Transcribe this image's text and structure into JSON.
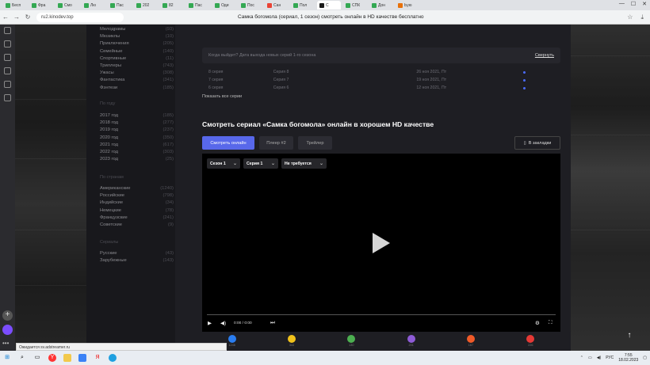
{
  "browser": {
    "tabs": [
      {
        "label": "Бесп",
        "color": "#34a853"
      },
      {
        "label": "Фра",
        "color": "#34a853"
      },
      {
        "label": "Смо",
        "color": "#34a853"
      },
      {
        "label": "Лю",
        "color": "#34a853"
      },
      {
        "label": "Пас",
        "color": "#34a853"
      },
      {
        "label": "202",
        "color": "#34a853"
      },
      {
        "label": "82",
        "color": "#34a853"
      },
      {
        "label": "Пас",
        "color": "#34a853"
      },
      {
        "label": "Оди",
        "color": "#34a853"
      },
      {
        "label": "Пос",
        "color": "#34a853"
      },
      {
        "label": "Сан",
        "color": "#ea4335"
      },
      {
        "label": "Пол",
        "color": "#34a853"
      },
      {
        "label": "С",
        "color": "#1a1a1a",
        "active": true
      },
      {
        "label": "СПК",
        "color": "#34a853"
      },
      {
        "label": "Дон",
        "color": "#34a853"
      },
      {
        "label": "Ьую",
        "color": "#e8710a"
      }
    ],
    "url": "ru2.kinodev.top",
    "page_title": "Самка богомола (сериал, 1 сезон) смотреть онлайн в HD качестве бесплатно",
    "status_text": "Ожидается sv.adstreamer.ru"
  },
  "categories": [
    {
      "label": "Мелодрамы",
      "count": "(93)"
    },
    {
      "label": "Мюзиклы",
      "count": "(10)"
    },
    {
      "label": "Приключения",
      "count": "(205)"
    },
    {
      "label": "Семейные",
      "count": "(140)"
    },
    {
      "label": "Спортивные",
      "count": "(11)"
    },
    {
      "label": "Триллеры",
      "count": "(743)"
    },
    {
      "label": "Ужасы",
      "count": "(308)"
    },
    {
      "label": "Фантастика",
      "count": "(341)"
    },
    {
      "label": "Фэнтези",
      "count": "(185)"
    }
  ],
  "by_year": {
    "title": "По году",
    "items": [
      {
        "label": "2017 год",
        "count": "(185)"
      },
      {
        "label": "2018 год",
        "count": "(277)"
      },
      {
        "label": "2019 год",
        "count": "(237)"
      },
      {
        "label": "2020 год",
        "count": "(350)"
      },
      {
        "label": "2021 год",
        "count": "(617)"
      },
      {
        "label": "2022 год",
        "count": "(303)"
      },
      {
        "label": "2023 год",
        "count": "(25)"
      }
    ]
  },
  "by_country": {
    "title": "По странам",
    "items": [
      {
        "label": "Американские",
        "count": "(1240)"
      },
      {
        "label": "Российские",
        "count": "(798)"
      },
      {
        "label": "Индийские",
        "count": "(34)"
      },
      {
        "label": "Немецкие",
        "count": "(78)"
      },
      {
        "label": "Французские",
        "count": "(241)"
      },
      {
        "label": "Советские",
        "count": "(9)"
      }
    ]
  },
  "series_group": {
    "title": "Сериалы",
    "items": [
      {
        "label": "Русские",
        "count": "(43)"
      },
      {
        "label": "Зарубежные",
        "count": "(143)"
      }
    ]
  },
  "release": {
    "question": "Когда выйдет? Дата выхода новых серий 1-го сезона",
    "collapse": "Свернуть"
  },
  "episodes": [
    {
      "num": "8 серия",
      "name": "Серия 8",
      "date": "26 ноя 2021, Пт"
    },
    {
      "num": "7 серия",
      "name": "Серия 7",
      "date": "19 ноя 2021, Пт"
    },
    {
      "num": "6 серия",
      "name": "Серия 6",
      "date": "12 ноя 2021, Пт"
    }
  ],
  "show_all": "Показать все серии",
  "watch_heading": "Смотреть сериал «Самка богомола» онлайн в хорошем HD качестве",
  "player_tabs": [
    "Смотреть онлайн",
    "Плеер #2",
    "Трейлер"
  ],
  "bookmark_label": "В закладки",
  "player": {
    "season": "Сезон 1",
    "episode": "Серия 1",
    "translation": "Не требуется",
    "time": "0:00 / 0:00"
  },
  "reactions": [
    {
      "name": "like",
      "color": "#2a7df0",
      "count": "1246"
    },
    {
      "name": "laugh",
      "color": "#f1c21b",
      "count": "344"
    },
    {
      "name": "wow",
      "color": "#4caf50",
      "count": "130"
    },
    {
      "name": "sad",
      "color": "#8e5bd6",
      "count": "201"
    },
    {
      "name": "angry",
      "color": "#f05a28",
      "count": "167"
    },
    {
      "name": "dislike",
      "color": "#e53935",
      "count": "226"
    }
  ],
  "clock": {
    "time": "7:55",
    "date": "18.02.2023",
    "lang": "РУС"
  }
}
